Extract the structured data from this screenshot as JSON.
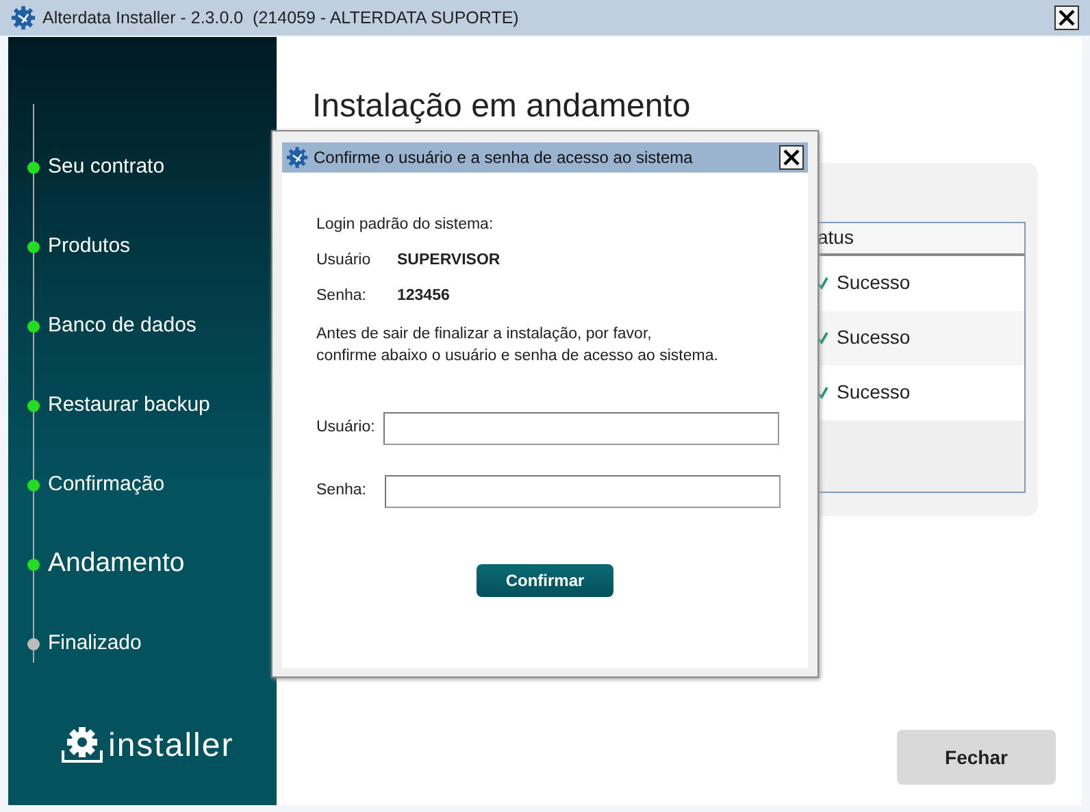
{
  "window": {
    "title": "Alterdata Installer - 2.3.0.0  (214059 - ALTERDATA SUPORTE)"
  },
  "sidebar": {
    "steps": [
      {
        "label": "Seu contrato",
        "kind": "done"
      },
      {
        "label": "Produtos",
        "kind": "done"
      },
      {
        "label": "Banco de dados",
        "kind": "done"
      },
      {
        "label": "Restaurar backup",
        "kind": "done"
      },
      {
        "label": "Confirmação",
        "kind": "done"
      },
      {
        "label": "Andamento",
        "kind": "current"
      },
      {
        "label": "Finalizado",
        "kind": "pending"
      }
    ],
    "logo_text": "installer"
  },
  "main": {
    "heading": "Instalação em andamento",
    "table": {
      "header": "atus",
      "rows": [
        {
          "status": "Sucesso"
        },
        {
          "status": "Sucesso"
        },
        {
          "status": "Sucesso"
        }
      ]
    },
    "close_button": "Fechar"
  },
  "dialog": {
    "title": "Confirme o usuário e a senha de acesso ao sistema",
    "intro": "Login padrão do sistema:",
    "credentials": [
      {
        "label": "Usuário",
        "value": "SUPERVISOR"
      },
      {
        "label": "Senha:",
        "value": "123456"
      }
    ],
    "message": [
      "Antes de sair de finalizar a instalação, por favor,",
      "confirme abaixo o usuário e senha de acesso ao sistema."
    ],
    "fields": [
      {
        "label": "Usuário:"
      },
      {
        "label": "Senha:"
      }
    ],
    "confirm_button": "Confirmar"
  }
}
